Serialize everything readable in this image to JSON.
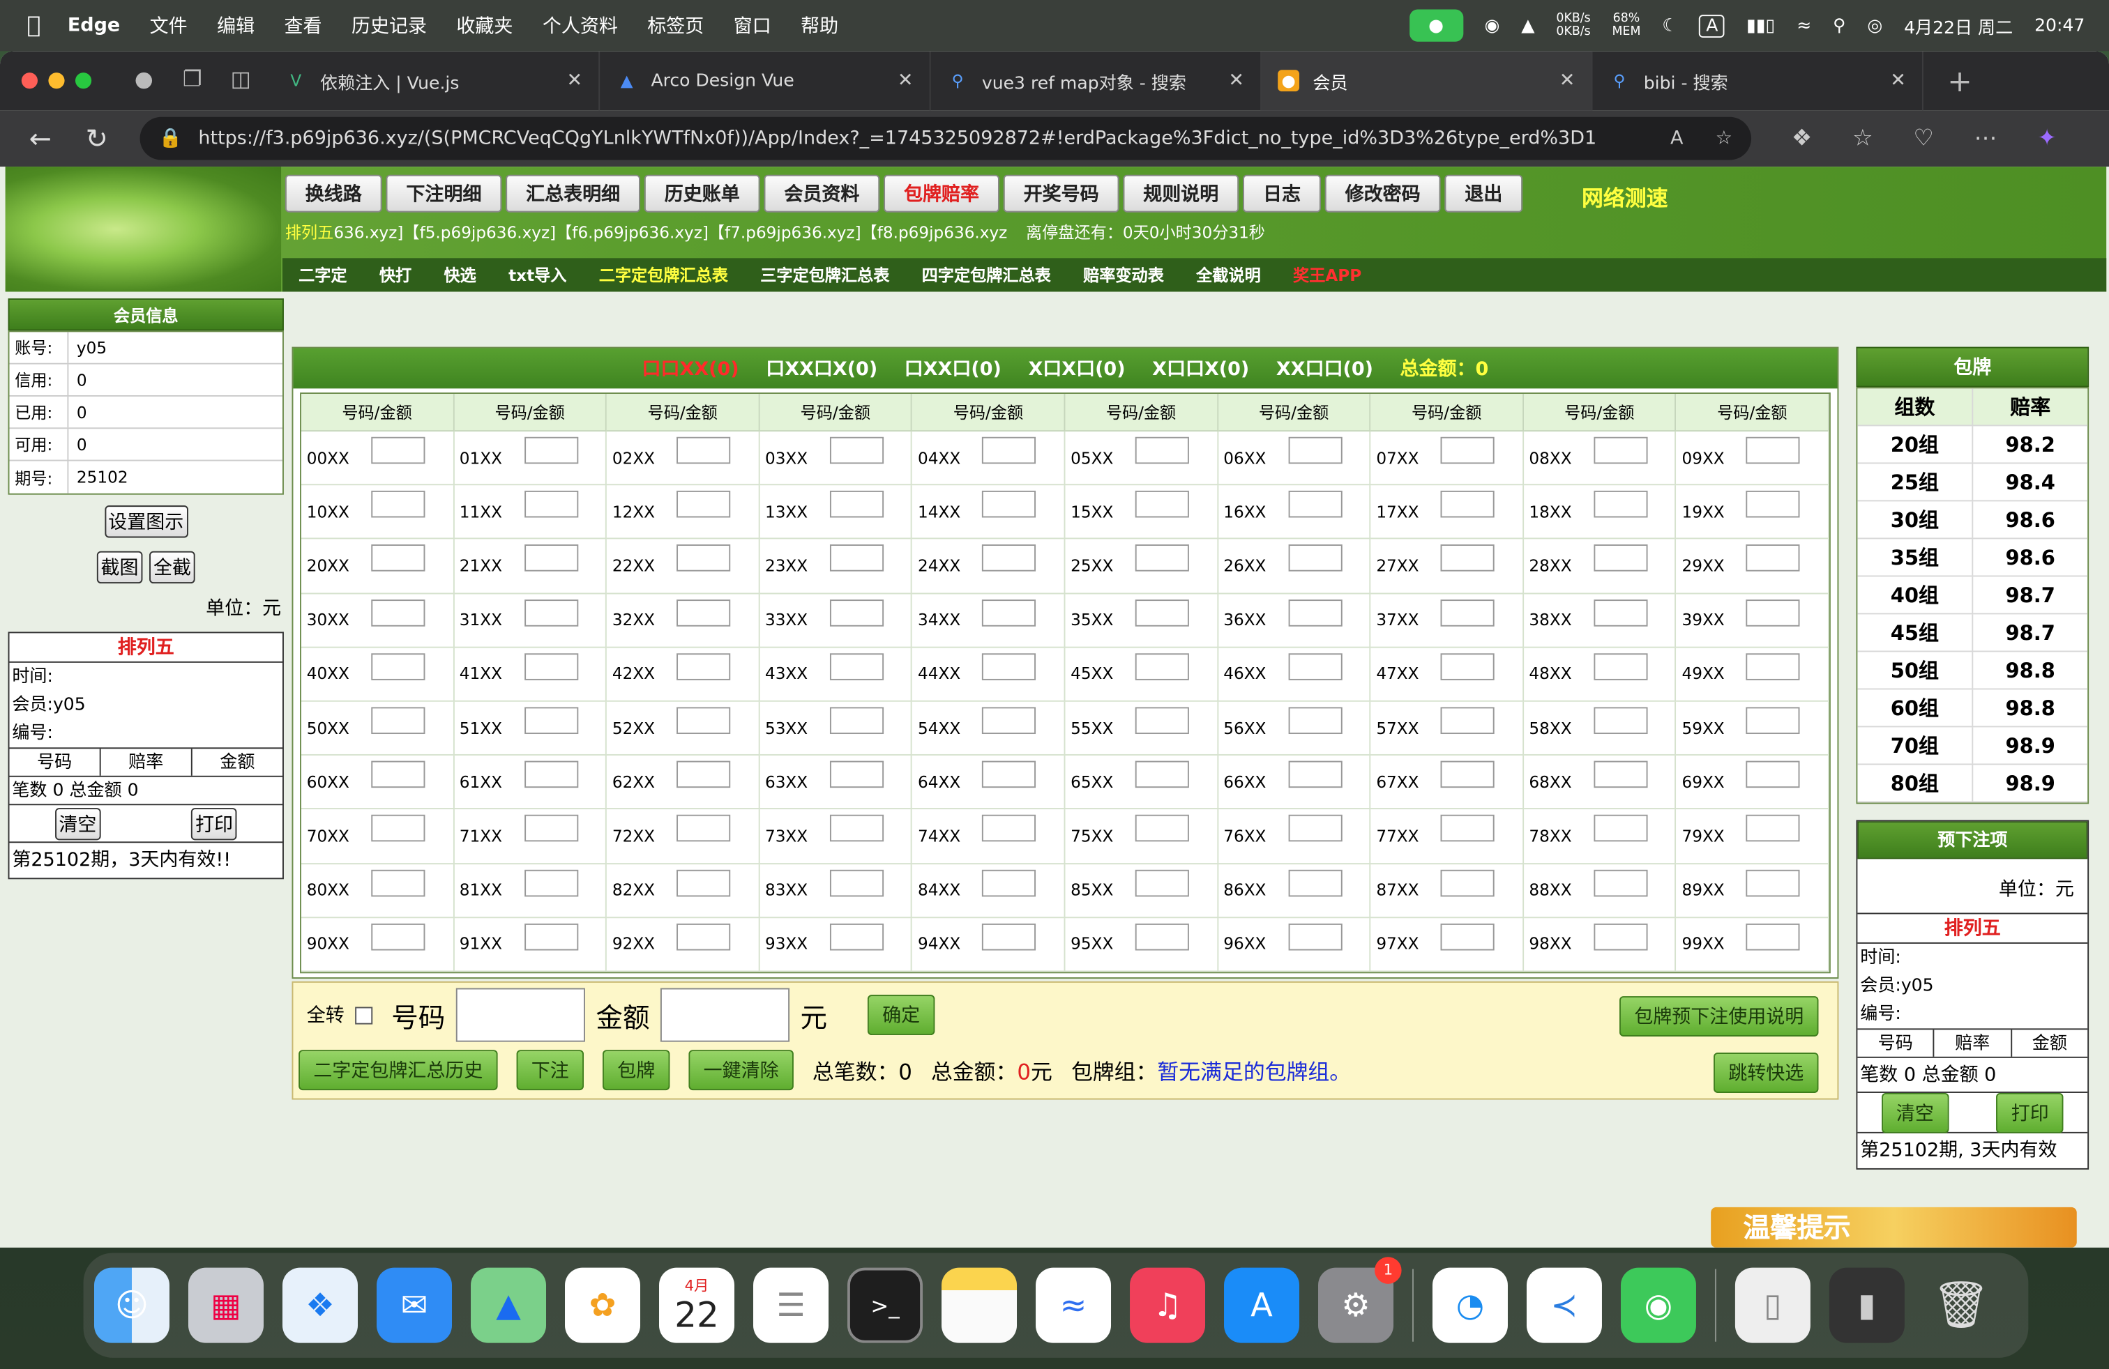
{
  "menubar": {
    "app": "Edge",
    "items": [
      "文件",
      "编辑",
      "查看",
      "历史记录",
      "收藏夹",
      "个人资料",
      "标签页",
      "窗口",
      "帮助"
    ],
    "net_up": "0KB/s",
    "net_down": "0KB/s",
    "mem": "68%",
    "mem_label": "MEM",
    "input": "A",
    "date": "4月22日 周二",
    "time": "20:47"
  },
  "tabs": [
    {
      "title": "依赖注入 | Vue.js"
    },
    {
      "title": "Arco Design Vue"
    },
    {
      "title": "vue3 ref map对象 - 搜索"
    },
    {
      "title": "会员"
    },
    {
      "title": "bibi - 搜索"
    }
  ],
  "url": "https://f3.p69jp636.xyz/(S(PMCRCVeqCQgYLnlkYWTfNx0f))/App/Index?_=1745325092872#!erdPackage%3Fdict_no_type_id%3D3%26type_erd%3D1",
  "topnav": [
    "换线路",
    "下注明细",
    "汇总表明细",
    "历史账单",
    "会员资料",
    "包牌赔率",
    "开奖号码",
    "规则说明",
    "日志",
    "修改密码",
    "退出"
  ],
  "netspeed": "网络测速",
  "infoline": {
    "prefix": "排列五",
    "links": "636.xyz]【f5.p69jp636.xyz]【f6.p69jp636.xyz]【f7.p69jp636.xyz]【f8.p69jp636.xyz",
    "countdown": "离停盘还有：0天0小时30分31秒"
  },
  "subnav": [
    "二字定",
    "快打",
    "快选",
    "txt导入",
    "二字定包牌汇总表",
    "三字定包牌汇总表",
    "四字定包牌汇总表",
    "赔率变动表",
    "全截说明",
    "奖王APP"
  ],
  "member": {
    "title": "会员信息",
    "rows": [
      {
        "k": "账号:",
        "v": "y05"
      },
      {
        "k": "信用:",
        "v": "0"
      },
      {
        "k": "已用:",
        "v": "0"
      },
      {
        "k": "可用:",
        "v": "0"
      },
      {
        "k": "期号:",
        "v": "25102"
      }
    ],
    "btn_icon": "设置图示",
    "btn_shot": "截图",
    "btn_all": "全截",
    "unit": "单位：元"
  },
  "receipt": {
    "title": "排列五",
    "time": "时间:",
    "member": "会员:y05",
    "code": "编号:",
    "cols": [
      "号码",
      "赔率",
      "金额"
    ],
    "total": "笔数 0 总金额 0",
    "clear": "清空",
    "print": "打印",
    "note": "第25102期，3天内有效!!"
  },
  "mainhead": {
    "items": [
      "口口XX(0)",
      "口XX口X(0)",
      "口XX口(0)",
      "X口X口(0)",
      "X口口X(0)",
      "XX口口(0)"
    ],
    "total": "总金额：0"
  },
  "grid": {
    "col_header": "号码/金额"
  },
  "bottom": {
    "allturn": "全转",
    "code": "号码",
    "amount": "金额",
    "yuan": "元",
    "confirm": "确定",
    "help": "包牌预下注使用说明",
    "history": "二字定包牌汇总历史",
    "bet": "下注",
    "pack": "包牌",
    "clearall": "一鍵清除",
    "count": "总笔数：0",
    "total_label": "总金额：",
    "total_val": "0",
    "total_unit": "元",
    "group_label": "包牌组：",
    "group_val": "暂无满足的包牌组。",
    "jump": "跳转快选"
  },
  "package": {
    "title": "包牌",
    "h1": "组数",
    "h2": "赔率",
    "rows": [
      [
        "20组",
        "98.2"
      ],
      [
        "25组",
        "98.4"
      ],
      [
        "30组",
        "98.6"
      ],
      [
        "35组",
        "98.6"
      ],
      [
        "40组",
        "98.7"
      ],
      [
        "45组",
        "98.7"
      ],
      [
        "50组",
        "98.8"
      ],
      [
        "60组",
        "98.8"
      ],
      [
        "70组",
        "98.9"
      ],
      [
        "80组",
        "98.9"
      ]
    ]
  },
  "prebet": {
    "title": "预下注项",
    "unit": "单位：元",
    "title2": "排列五",
    "time": "时间:",
    "member": "会员:y05",
    "code": "编号:",
    "cols": [
      "号码",
      "赔率",
      "金额"
    ],
    "total": "笔数 0 总金额 0",
    "clear": "清空",
    "print": "打印",
    "note": "第25102期, 3天内有效"
  },
  "promo": "温馨提示",
  "dock": {
    "calendar_month": "4月",
    "calendar_day": "22",
    "badge": "1"
  },
  "colors": {
    "green": "#4e8f24",
    "red": "#e02020",
    "yellow": "#ffff40"
  }
}
